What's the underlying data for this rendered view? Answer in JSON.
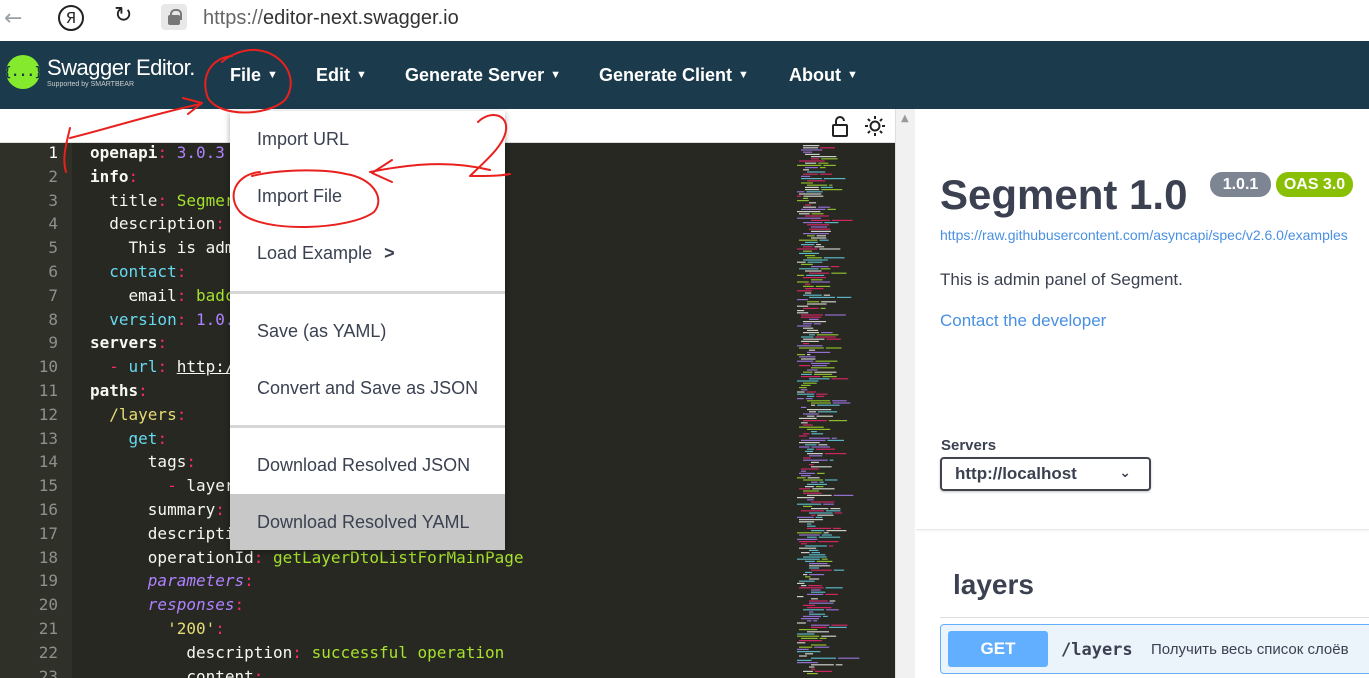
{
  "browser": {
    "url_prefix": "https://",
    "url_host": "editor-next.swagger.io",
    "ya_glyph": "Я"
  },
  "app": {
    "logo_glyph": "{...}",
    "logo_title": "Swagger Editor.",
    "logo_sub": "Supported by SMARTBEAR"
  },
  "menu": [
    {
      "label": "File"
    },
    {
      "label": "Edit"
    },
    {
      "label": "Generate Server"
    },
    {
      "label": "Generate Client"
    },
    {
      "label": "About"
    }
  ],
  "file_menu": {
    "import_url": "Import URL",
    "import_file": "Import File",
    "load_example": "Load Example",
    "load_example_arrow": ">",
    "save_yaml": "Save (as YAML)",
    "convert_json": "Convert and Save as JSON",
    "download_json": "Download Resolved JSON",
    "download_yaml": "Download Resolved YAML"
  },
  "editor": {
    "lines": [
      {
        "n": "1",
        "html": "<span class=\"kb\">openapi</span><span class=\"k\">:</span> <span class=\"n\">3.0.3</span>"
      },
      {
        "n": "2",
        "html": "<span class=\"kb\">info</span><span class=\"k\">:</span>"
      },
      {
        "n": "3",
        "html": "  <span class=\"key\">title</span><span class=\"k\">:</span> <span class=\"s\">Segmer</span>"
      },
      {
        "n": "4",
        "html": "  <span class=\"key\">description</span><span class=\"k\">:</span>"
      },
      {
        "n": "5",
        "html": "    This is adm"
      },
      {
        "n": "6",
        "html": "  <span class=\"n\" style=\"color:#66d9ef\">contact</span><span class=\"k\">:</span>"
      },
      {
        "n": "7",
        "html": "    <span class=\"key\">email</span><span class=\"k\">:</span> <span class=\"s\">badc</span>"
      },
      {
        "n": "8",
        "html": "  <span class=\"n\" style=\"color:#66d9ef\">version</span><span class=\"k\">:</span> <span class=\"n\">1.0.</span>"
      },
      {
        "n": "9",
        "html": "<span class=\"kb\">servers</span><span class=\"k\">:</span>"
      },
      {
        "n": "10",
        "html": "  <span class=\"k\">-</span> <span class=\"n\" style=\"color:#66d9ef\">url</span><span class=\"k\">:</span> <span style=\"text-decoration:underline\">http:/</span>"
      },
      {
        "n": "11",
        "html": "<span class=\"kb\">paths</span><span class=\"k\">:</span>"
      },
      {
        "n": "12",
        "html": "  <span class=\"s\" style=\"color:#e6db74\">/layers</span><span class=\"k\">:</span>"
      },
      {
        "n": "13",
        "html": "    <span style=\"color:#66d9ef\">get</span><span class=\"k\">:</span>"
      },
      {
        "n": "14",
        "html": "      <span class=\"key\">tags</span><span class=\"k\">:</span>"
      },
      {
        "n": "15",
        "html": "        <span class=\"k\">-</span> layer"
      },
      {
        "n": "16",
        "html": "      <span class=\"key\">summary</span><span class=\"k\">:</span>"
      },
      {
        "n": "17",
        "html": "      descripti"
      },
      {
        "n": "18",
        "html": "      <span class=\"key\">operationId</span><span class=\"k\">:</span> <span class=\"s\">getLayerDtoListForMainPage</span>"
      },
      {
        "n": "19",
        "html": "      <span style=\"color:#ae81ff;font-style:italic\">parameters</span><span class=\"k\">:</span>"
      },
      {
        "n": "20",
        "html": "      <span style=\"color:#ae81ff;font-style:italic\">responses</span><span class=\"k\">:</span>"
      },
      {
        "n": "21",
        "html": "        <span style=\"color:#e6db74\">'200'</span><span class=\"k\">:</span>"
      },
      {
        "n": "22",
        "html": "          <span class=\"key\">description</span><span class=\"k\">:</span> <span class=\"s\">successful operation</span>"
      },
      {
        "n": "23",
        "html": "          <span class=\"key\">content</span><span class=\"k\">:</span>"
      }
    ]
  },
  "info": {
    "title": "Segment 1.0",
    "version_badge": "1.0.1",
    "oas_badge": "OAS 3.0",
    "url": "https://raw.githubusercontent.com/asyncapi/spec/v2.6.0/examples",
    "description": "This is admin panel of Segment.",
    "contact": "Contact the developer"
  },
  "servers": {
    "label": "Servers",
    "selected": "http://localhost",
    "chevron": "⌄"
  },
  "tag": {
    "name": "layers",
    "operation": {
      "method": "GET",
      "path": "/layers",
      "summary": "Получить весь список слоёв"
    }
  },
  "annotations": {
    "label_1": "1",
    "label_2": "2",
    "color": "#e8211e"
  }
}
